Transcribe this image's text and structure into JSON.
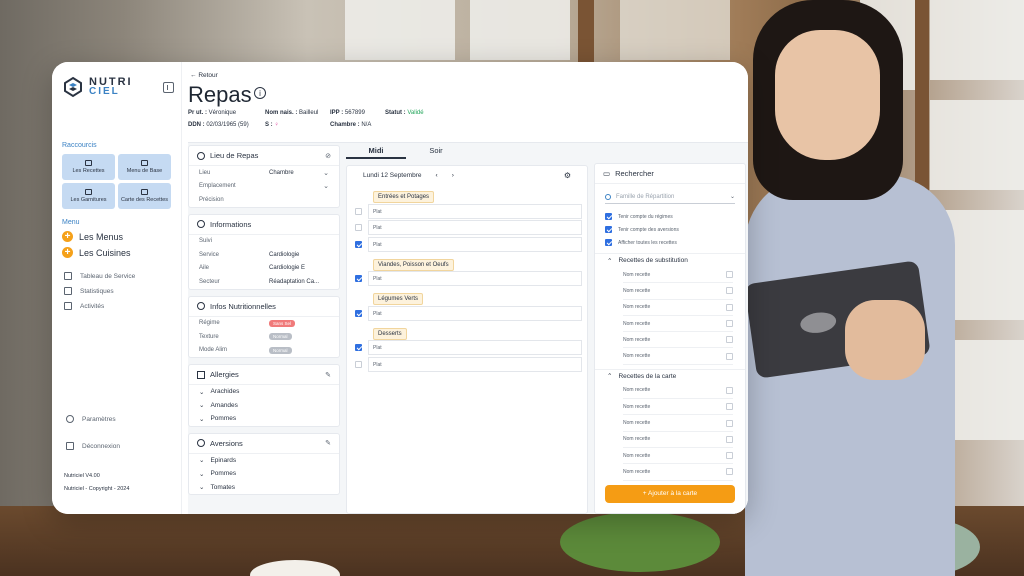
{
  "brand": {
    "line1": "NUTRI",
    "line2": "CIEL"
  },
  "sidebar": {
    "shortcuts_label": "Raccourcis",
    "shortcuts": [
      "Les Recettes",
      "Menu de Base",
      "Les Garnitures",
      "Carte des Recettes"
    ],
    "menu_label": "Menu",
    "menu_items": [
      "Les Menus",
      "Les Cuisines"
    ],
    "nav": [
      "Tableau de Service",
      "Statistiques",
      "Activités"
    ],
    "settings": "Paramètres",
    "logout": "Déconnexion",
    "version": "Nutriciel V4.00",
    "copyright": "Nutriciel - Copyright - 2024"
  },
  "header": {
    "back": "Retour",
    "title": "Repas",
    "info_icon": "i",
    "pr_label": "Pr ut. :",
    "pr_value": "Véronique",
    "birthname_label": "Nom nais. :",
    "birthname_value": "Bailleul",
    "ipp_label": "IPP :",
    "ipp_value": "567899",
    "status_label": "Statut :",
    "status_value": "Validé",
    "ddn_label": "DDN :",
    "ddn_value": "02/03/1965 (59)",
    "sex_label": "S :",
    "sex_value": "♀",
    "room_label": "Chambre :",
    "room_value": "N/A"
  },
  "lieu": {
    "title": "Lieu de Repas",
    "rows": [
      {
        "k": "Lieu",
        "v": "Chambre"
      },
      {
        "k": "Emplacement",
        "v": ""
      },
      {
        "k": "Précision",
        "v": ""
      }
    ]
  },
  "informations": {
    "title": "Informations",
    "rows": [
      {
        "k": "Suivi",
        "v": ""
      },
      {
        "k": "Service",
        "v": "Cardiologie"
      },
      {
        "k": "Aile",
        "v": "Cardiologie E"
      },
      {
        "k": "Secteur",
        "v": "Réadaptation Ca..."
      }
    ]
  },
  "nutrition": {
    "title": "Infos Nutritionnelles",
    "rows": [
      {
        "k": "Régime",
        "v": "Sans Sel",
        "color": "#f07a7a"
      },
      {
        "k": "Texture",
        "v": "Normal",
        "color": "#b9bec6"
      },
      {
        "k": "Mode Alim",
        "v": "Normal",
        "color": "#b9bec6"
      }
    ]
  },
  "allergies": {
    "title": "Allergies",
    "items": [
      "Arachides",
      "Amandes",
      "Pommes"
    ]
  },
  "aversions": {
    "title": "Aversions",
    "items": [
      "Epinards",
      "Pommes",
      "Tomates"
    ]
  },
  "meal": {
    "tabs": [
      "Midi",
      "Soir"
    ],
    "date": "Lundi 12 Septembre",
    "categories": [
      {
        "name": "Entrées et Potages",
        "dishes": [
          {
            "label": "Plat",
            "checked": false
          },
          {
            "label": "Plat",
            "checked": false
          },
          {
            "label": "Plat",
            "checked": true
          }
        ]
      },
      {
        "name": "Viandes, Poisson et Oeufs",
        "dishes": [
          {
            "label": "Plat",
            "checked": true
          }
        ]
      },
      {
        "name": "Légumes Verts",
        "dishes": [
          {
            "label": "Plat",
            "checked": true
          }
        ]
      },
      {
        "name": "Desserts",
        "dishes": [
          {
            "label": "Plat",
            "checked": true
          },
          {
            "label": "Plat",
            "checked": false
          }
        ]
      }
    ]
  },
  "search": {
    "title": "Rechercher",
    "placeholder": "Famille de Répartition",
    "options": [
      "Tenir compte du régimes",
      "Tenir compte des aversions",
      "Afficher toutes les recettes"
    ],
    "group1": "Recettes de substitution",
    "group2": "Recettes de la carte",
    "recipe_label": "Nom recette",
    "add_button": "+ Ajouter à la carte"
  }
}
